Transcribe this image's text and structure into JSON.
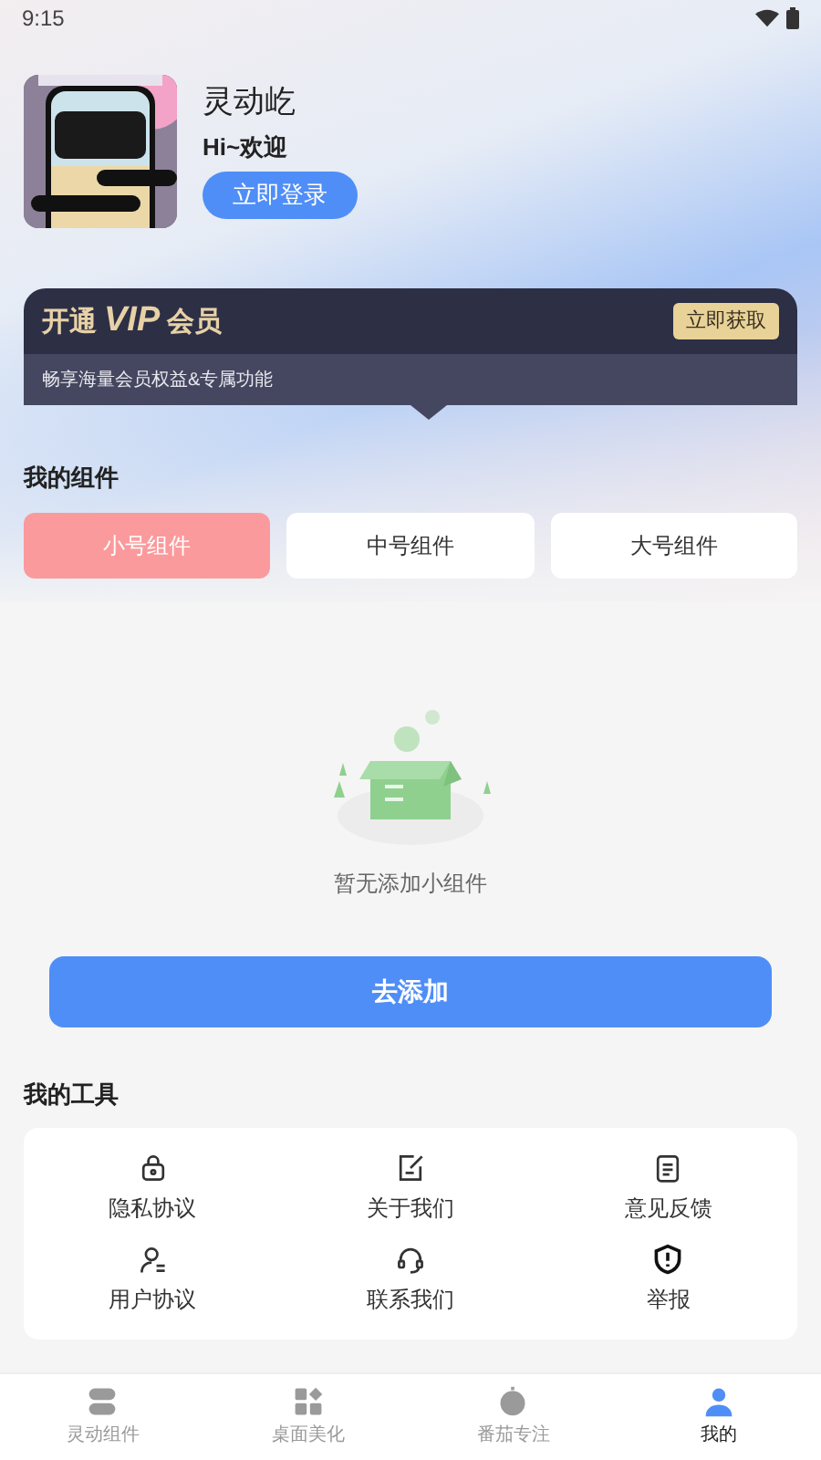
{
  "status_bar": {
    "time": "9:15"
  },
  "profile": {
    "app_name": "灵动屹",
    "greeting": "Hi~欢迎",
    "login_button": "立即登录"
  },
  "vip_banner": {
    "title_prefix": "开通",
    "title_vip": "VIP",
    "title_suffix": "会员",
    "action": "立即获取",
    "subtitle": "畅享海量会员权益&专属功能"
  },
  "widgets": {
    "title": "我的组件",
    "tabs": [
      {
        "label": "小号组件",
        "selected": true
      },
      {
        "label": "中号组件",
        "selected": false
      },
      {
        "label": "大号组件",
        "selected": false
      }
    ],
    "empty_text": "暂无添加小组件",
    "add_button": "去添加"
  },
  "tools": {
    "title": "我的工具",
    "items": [
      {
        "kind": "lock",
        "label": "隐私协议"
      },
      {
        "kind": "note",
        "label": "关于我们"
      },
      {
        "kind": "clipboard",
        "label": "意见反馈"
      },
      {
        "kind": "user",
        "label": "用户协议"
      },
      {
        "kind": "headset",
        "label": "联系我们"
      },
      {
        "kind": "shield",
        "label": "举报"
      }
    ]
  },
  "bottom_nav": [
    {
      "kind": "toggles",
      "label": "灵动组件",
      "selected": false
    },
    {
      "kind": "grid",
      "label": "桌面美化",
      "selected": false
    },
    {
      "kind": "tomato",
      "label": "番茄专注",
      "selected": false
    },
    {
      "kind": "person",
      "label": "我的",
      "selected": true
    }
  ]
}
